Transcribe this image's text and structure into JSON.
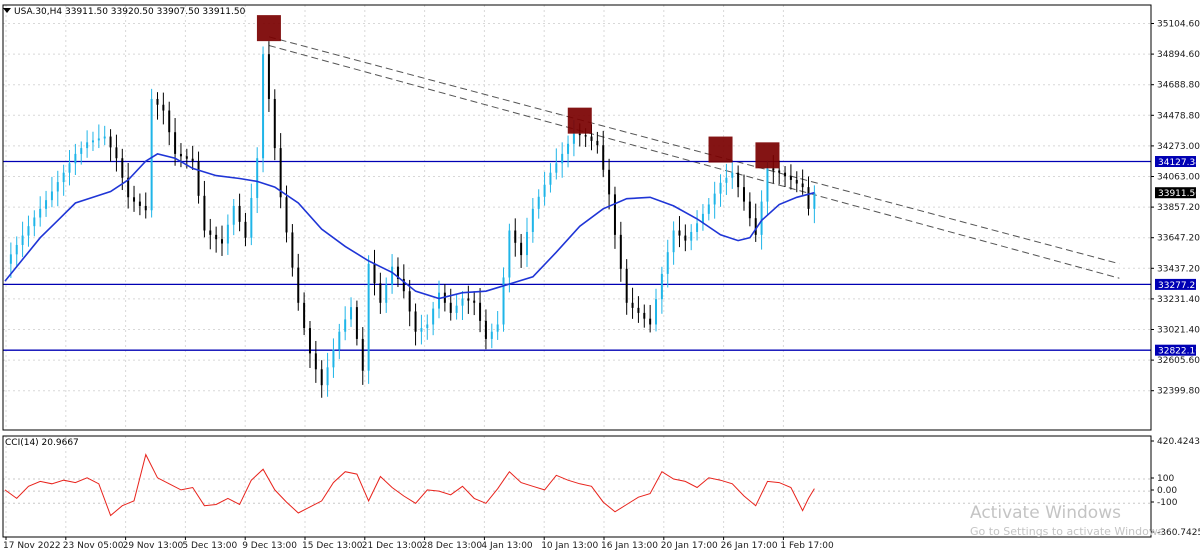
{
  "header": {
    "symbol_info": "USA.30,H4  33911.50 33920.50 33907.50 33911.50",
    "cci_label": "CCI(14) 20.9667"
  },
  "watermark": {
    "title": "Activate Windows",
    "subtitle": "Go to Settings to activate Windows."
  },
  "colors": {
    "bull_candle": "#1fb5e8",
    "bear_candle": "#000000",
    "moving_average": "#1f35d6",
    "level_line": "#0000b4",
    "level_label_bg": "#0000b4",
    "trendline": "#555555",
    "marker": "#7a0000",
    "cci_line": "#e8231c",
    "grid": "#d8d8d8",
    "price_label_bg": "#000000"
  },
  "chart_data": [
    {
      "type": "candlestick",
      "symbol": "USA.30",
      "timeframe": "H4",
      "x_labels": [
        "17 Nov 2022",
        "23 Nov 05:00",
        "29 Nov 13:00",
        "5 Dec 13:00",
        "9 Dec 13:00",
        "15 Dec 13:00",
        "21 Dec 13:00",
        "28 Dec 13:00",
        "4 Jan 13:00",
        "10 Jan 13:00",
        "16 Jan 13:00",
        "20 Jan 17:00",
        "26 Jan 17:00",
        "1 Feb 17:00"
      ],
      "y_ticks": [
        "35104.60",
        "34894.60",
        "34688.80",
        "34478.80",
        "34273.00",
        "34063.00",
        "33857.20",
        "33647.20",
        "33437.20",
        "33231.40",
        "33021.40",
        "32605.60",
        "32399.80"
      ],
      "ylim": [
        32270,
        35210
      ],
      "grid": true,
      "current_price": "33911.50",
      "horizontal_levels": [
        "34127.34",
        "33277.21",
        "32822.16"
      ],
      "candles": [
        [
          0,
          33420
        ],
        [
          4,
          33680
        ],
        [
          8,
          33920
        ],
        [
          12,
          34180
        ],
        [
          14,
          34260
        ],
        [
          17,
          34300
        ],
        [
          19,
          34150
        ],
        [
          21,
          33880
        ],
        [
          24,
          33790
        ],
        [
          25,
          34560
        ],
        [
          27,
          34480
        ],
        [
          29,
          34180
        ],
        [
          32,
          34130
        ],
        [
          34,
          33650
        ],
        [
          37,
          33560
        ],
        [
          39,
          33820
        ],
        [
          41,
          33600
        ],
        [
          43,
          34150
        ],
        [
          44,
          34870
        ],
        [
          45,
          34560
        ],
        [
          47,
          33880
        ],
        [
          50,
          33150
        ],
        [
          52,
          32800
        ],
        [
          54,
          32580
        ],
        [
          57,
          32950
        ],
        [
          59,
          33120
        ],
        [
          61,
          32680
        ],
        [
          62,
          33420
        ],
        [
          64,
          33150
        ],
        [
          66,
          33400
        ],
        [
          68,
          33230
        ],
        [
          70,
          32950
        ],
        [
          72,
          33000
        ],
        [
          74,
          33220
        ],
        [
          76,
          33080
        ],
        [
          78,
          33180
        ],
        [
          80,
          33150
        ],
        [
          82,
          32900
        ],
        [
          84,
          33000
        ],
        [
          86,
          33650
        ],
        [
          88,
          33480
        ],
        [
          90,
          33800
        ],
        [
          93,
          34050
        ],
        [
          95,
          34180
        ],
        [
          97,
          34320
        ],
        [
          99,
          34300
        ],
        [
          101,
          34240
        ],
        [
          103,
          33900
        ],
        [
          104,
          33620
        ],
        [
          106,
          33150
        ],
        [
          108,
          33080
        ],
        [
          110,
          33000
        ],
        [
          112,
          33350
        ],
        [
          114,
          33650
        ],
        [
          116,
          33580
        ],
        [
          118,
          33700
        ],
        [
          120,
          33830
        ],
        [
          122,
          33980
        ],
        [
          124,
          34050
        ],
        [
          126,
          33850
        ],
        [
          128,
          33620
        ],
        [
          130,
          34080
        ],
        [
          132,
          34050
        ],
        [
          134,
          34000
        ],
        [
          136,
          33950
        ],
        [
          137,
          33800
        ],
        [
          138,
          33911.5
        ]
      ],
      "moving_average": [
        [
          0,
          33300
        ],
        [
          3,
          33450
        ],
        [
          6,
          33600
        ],
        [
          9,
          33720
        ],
        [
          12,
          33840
        ],
        [
          15,
          33880
        ],
        [
          18,
          33920
        ],
        [
          21,
          34000
        ],
        [
          24,
          34130
        ],
        [
          26,
          34180
        ],
        [
          29,
          34150
        ],
        [
          32,
          34080
        ],
        [
          36,
          34030
        ],
        [
          40,
          34010
        ],
        [
          43,
          33990
        ],
        [
          46,
          33950
        ],
        [
          50,
          33840
        ],
        [
          54,
          33660
        ],
        [
          58,
          33540
        ],
        [
          62,
          33440
        ],
        [
          66,
          33360
        ],
        [
          70,
          33230
        ],
        [
          74,
          33180
        ],
        [
          78,
          33220
        ],
        [
          82,
          33230
        ],
        [
          86,
          33280
        ],
        [
          90,
          33330
        ],
        [
          94,
          33500
        ],
        [
          98,
          33680
        ],
        [
          102,
          33800
        ],
        [
          106,
          33870
        ],
        [
          110,
          33880
        ],
        [
          114,
          33820
        ],
        [
          118,
          33730
        ],
        [
          122,
          33620
        ],
        [
          125,
          33580
        ],
        [
          127,
          33600
        ],
        [
          129,
          33720
        ],
        [
          132,
          33830
        ],
        [
          135,
          33880
        ],
        [
          138,
          33911.5
        ]
      ],
      "trendlines": [
        {
          "from": [
            45,
            34990
          ],
          "to": [
            190,
            33420
          ]
        },
        {
          "from": [
            45,
            34930
          ],
          "to": [
            190,
            33320
          ]
        }
      ],
      "markers": [
        [
          45,
          35050
        ],
        [
          98,
          34410
        ],
        [
          122,
          34210
        ],
        [
          130,
          34170
        ]
      ]
    },
    {
      "type": "line",
      "name": "CCI(14)",
      "y_ticks": [
        "420.4243",
        "100",
        "0.00",
        "-100",
        "-360.7425"
      ],
      "ylim": [
        -360.7425,
        420.4243
      ],
      "value": "20.9667",
      "values": [
        [
          0,
          10
        ],
        [
          2,
          -60
        ],
        [
          4,
          40
        ],
        [
          6,
          80
        ],
        [
          8,
          60
        ],
        [
          10,
          90
        ],
        [
          12,
          70
        ],
        [
          14,
          110
        ],
        [
          16,
          60
        ],
        [
          18,
          -200
        ],
        [
          20,
          -120
        ],
        [
          22,
          -80
        ],
        [
          24,
          300
        ],
        [
          26,
          110
        ],
        [
          28,
          60
        ],
        [
          30,
          10
        ],
        [
          32,
          30
        ],
        [
          34,
          -120
        ],
        [
          36,
          -110
        ],
        [
          38,
          -60
        ],
        [
          40,
          -110
        ],
        [
          42,
          90
        ],
        [
          44,
          180
        ],
        [
          46,
          10
        ],
        [
          48,
          -90
        ],
        [
          50,
          -180
        ],
        [
          52,
          -130
        ],
        [
          54,
          -80
        ],
        [
          56,
          70
        ],
        [
          58,
          160
        ],
        [
          60,
          140
        ],
        [
          62,
          -80
        ],
        [
          64,
          120
        ],
        [
          66,
          30
        ],
        [
          68,
          -40
        ],
        [
          70,
          -100
        ],
        [
          72,
          10
        ],
        [
          74,
          0
        ],
        [
          76,
          -30
        ],
        [
          78,
          40
        ],
        [
          80,
          -60
        ],
        [
          82,
          -100
        ],
        [
          84,
          20
        ],
        [
          86,
          160
        ],
        [
          88,
          70
        ],
        [
          90,
          40
        ],
        [
          92,
          10
        ],
        [
          94,
          130
        ],
        [
          96,
          90
        ],
        [
          98,
          60
        ],
        [
          100,
          40
        ],
        [
          102,
          -90
        ],
        [
          104,
          -170
        ],
        [
          106,
          -110
        ],
        [
          108,
          -50
        ],
        [
          110,
          -20
        ],
        [
          112,
          160
        ],
        [
          114,
          100
        ],
        [
          116,
          80
        ],
        [
          118,
          30
        ],
        [
          120,
          110
        ],
        [
          122,
          90
        ],
        [
          124,
          60
        ],
        [
          126,
          -40
        ],
        [
          128,
          -120
        ],
        [
          130,
          80
        ],
        [
          132,
          70
        ],
        [
          134,
          30
        ],
        [
          136,
          -160
        ],
        [
          137,
          -60
        ],
        [
          138,
          20.9667
        ]
      ]
    }
  ]
}
